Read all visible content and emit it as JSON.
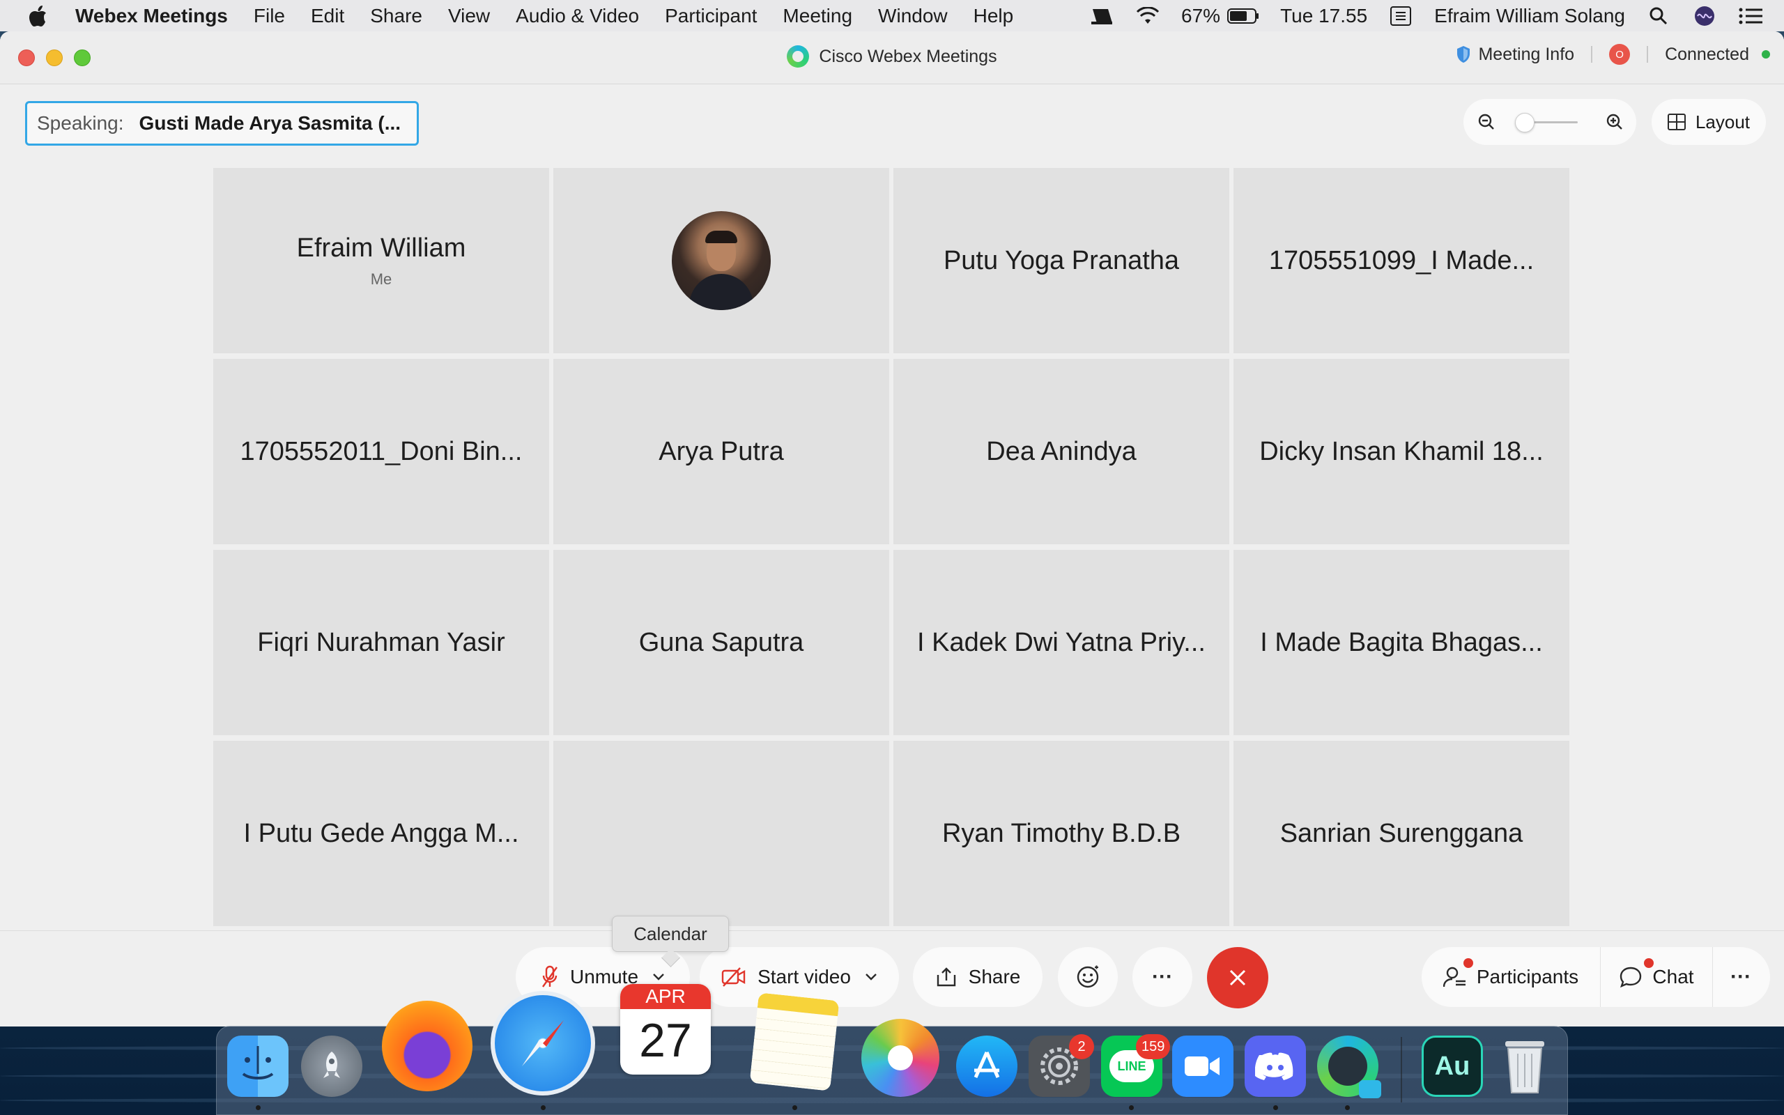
{
  "menubar": {
    "app_name": "Webex Meetings",
    "menus": [
      "File",
      "Edit",
      "Share",
      "View",
      "Audio & Video",
      "Participant",
      "Meeting",
      "Window",
      "Help"
    ],
    "battery": "67%",
    "clock": "Tue 17.55",
    "user": "Efraim William Solang"
  },
  "window": {
    "title": "Cisco Webex Meetings",
    "meeting_info": "Meeting Info",
    "record_letter": "O",
    "status": "Connected"
  },
  "speaking": {
    "label": "Speaking:",
    "name": "Gusti Made Arya Sasmita (..."
  },
  "layout_label": "Layout",
  "zoom_level": 0.05,
  "participants": [
    {
      "name": "Efraim William",
      "sub": "Me"
    },
    {
      "name": "",
      "avatar": true
    },
    {
      "name": "Putu Yoga Pranatha"
    },
    {
      "name": "1705551099_I Made..."
    },
    {
      "name": "1705552011_Doni Bin..."
    },
    {
      "name": "Arya Putra"
    },
    {
      "name": "Dea Anindya"
    },
    {
      "name": "Dicky Insan Khamil 18..."
    },
    {
      "name": "Fiqri Nurahman Yasir"
    },
    {
      "name": "Guna Saputra"
    },
    {
      "name": "I Kadek Dwi Yatna Priy..."
    },
    {
      "name": "I Made Bagita Bhagas..."
    },
    {
      "name": "I Putu Gede Angga M..."
    },
    {
      "name": ""
    },
    {
      "name": "Ryan Timothy B.D.B"
    },
    {
      "name": "Sanrian Surenggana"
    }
  ],
  "controls": {
    "unmute": "Unmute",
    "start_video": "Start video",
    "share": "Share",
    "participants": "Participants",
    "chat": "Chat",
    "more": "···"
  },
  "tooltip": "Calendar",
  "dock": {
    "calendar_month": "APR",
    "calendar_day": "27",
    "settings_badge": "2",
    "line_badge": "159",
    "line_label": "LINE",
    "audition_label": "Au"
  },
  "colors": {
    "accent": "#33a7e6",
    "end_call": "#e0352b",
    "connected": "#2fb24a"
  }
}
